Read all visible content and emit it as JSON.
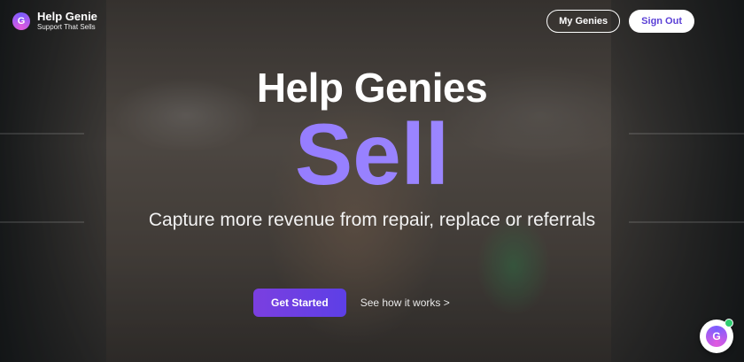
{
  "brand": {
    "name": "Help Genie",
    "tagline": "Support That Sells",
    "logo_letter": "G"
  },
  "nav": {
    "my_genies": "My Genies",
    "sign_out": "Sign Out"
  },
  "hero": {
    "headline": "Help Genies",
    "highlight": "Sell",
    "subheadline": "Capture more revenue from repair, replace or referrals",
    "primary_cta": "Get Started",
    "secondary_cta": "See how it works >"
  },
  "widget": {
    "logo_letter": "G",
    "status": "online"
  },
  "colors": {
    "accent": "#5d3fe6",
    "highlight_gradient_start": "#8a6bff",
    "status_online": "#2ecc71"
  }
}
